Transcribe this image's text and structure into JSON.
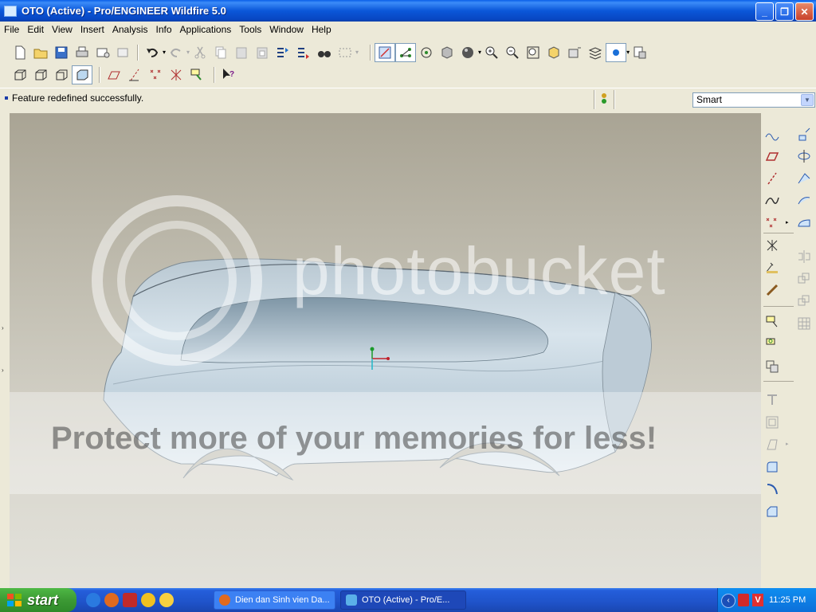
{
  "window": {
    "title": "OTO (Active) - Pro/ENGINEER Wildfire 5.0"
  },
  "menu": [
    "File",
    "Edit",
    "View",
    "Insert",
    "Analysis",
    "Info",
    "Applications",
    "Tools",
    "Window",
    "Help"
  ],
  "status": {
    "message": "Feature redefined successfully.",
    "filter_value": "Smart"
  },
  "watermark": {
    "brand": "photobucket",
    "slogan": "Protect more of your memories for less!"
  },
  "taskbar": {
    "start_label": "start",
    "tasks": [
      "Dien dan Sinh vien Da...",
      "OTO (Active) - Pro/E..."
    ],
    "clock": "11:25 PM"
  },
  "colors": {
    "title_blue": "#0b57d9",
    "taskbar_blue": "#245edb",
    "start_green": "#3c9a34",
    "model_surface": "#c9d8e2"
  }
}
